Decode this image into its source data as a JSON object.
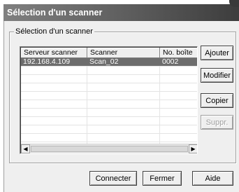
{
  "window": {
    "title": "Sélection d'un scanner"
  },
  "group": {
    "legend": "Sélection d'un scanner"
  },
  "list": {
    "columns": [
      "Serveur scanner",
      "Scanner",
      "No. boîte"
    ],
    "rows": [
      {
        "server": "192.168.4.109",
        "scanner": "Scan_02",
        "box": "0002",
        "selected": true
      }
    ],
    "empty_rows": 11
  },
  "side_buttons": {
    "add": "Ajouter",
    "modify": "Modifier",
    "copy": "Copier",
    "delete": "Suppr."
  },
  "bottom_buttons": {
    "connect": "Connecter",
    "close": "Fermer",
    "help": "Aide"
  },
  "icons": {
    "scroll_left": "chevron-left-icon",
    "scroll_right": "chevron-right-icon"
  }
}
